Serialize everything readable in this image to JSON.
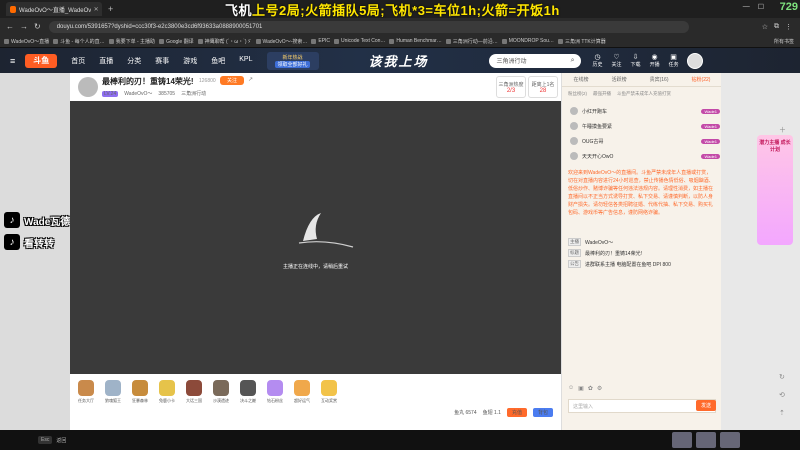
{
  "browser": {
    "tab_title": "WadeOvO～直播_WadeOvO～",
    "url": "douyu.com/5391657?dyshid=ccc30f3-e2c3800e3cd6f93633a0888900051701",
    "bookmarks": [
      "WadeOvO～直播",
      "斗鱼 - 每个人的直…",
      "我要下单 - 主播助",
      "Google 翻译",
      "神鹰聊帮 (´・ω・`)ゞ",
      "WadeOvO～-搜索…",
      "EPIC",
      "Unicode Text Con…",
      "Human Benchmar…",
      "三角洲行动—前沿…",
      "MOONDROP Sou…",
      "三角洲 TTK计算器"
    ],
    "bookmarks_right": "所有书签"
  },
  "overlay": {
    "title_prefix": "飞机",
    "title_mid": "上号2局;火箭插队5局;飞机*3=车位1h;火箭=开饭1h",
    "corner_number": "729"
  },
  "site": {
    "logo": "斗鱼",
    "nav": [
      "首页",
      "直播",
      "分类",
      "赛事",
      "游戏",
      "鱼吧",
      "KPL"
    ],
    "promo_line1": "新年热战",
    "promo_line2": "领取全部好礼",
    "banner": "该我上场",
    "search_placeholder": "三角洲行动",
    "header_icons": [
      "历史",
      "关注",
      "下载",
      "开播",
      "任务"
    ]
  },
  "stream": {
    "title": "最棒利的刃！重铸14荣光!",
    "room_id": "126800",
    "follow_label": "关注",
    "level": "LV.24",
    "streamer": "WadeOvO～",
    "fans": "385705",
    "category": "三角洲行动",
    "rank1_label": "三角洲热度",
    "rank1_value": "2/3",
    "rank2_label": "距离上1名",
    "rank2_value": "28"
  },
  "player": {
    "message": "主播正在连线中，请稍后重试"
  },
  "gifts": [
    {
      "name": "任务大厅",
      "color": "#c98a4b"
    },
    {
      "name": "狼魂狐王",
      "color": "#9fb3c8"
    },
    {
      "name": "狂暴森林",
      "color": "#c78c3c"
    },
    {
      "name": "兔鹿小卡",
      "color": "#e6c34a"
    },
    {
      "name": "大话三国",
      "color": "#8c4a3a"
    },
    {
      "name": "沙漠遗迹",
      "color": "#7a6a5a"
    },
    {
      "name": "决斗之巅",
      "color": "#555"
    },
    {
      "name": "钻石粉丝",
      "color": "#b48cf0"
    },
    {
      "name": "超好运气",
      "color": "#f0a84b"
    },
    {
      "name": "互动奖赏",
      "color": "#f2c34a"
    }
  ],
  "gift_footer": {
    "fishballs": "鱼丸 6574",
    "fishwings": "鱼翅 1.1",
    "recharge": "充值",
    "backpack": "背包"
  },
  "chat": {
    "tabs": [
      "在线榜",
      "活跃榜",
      "贵宾(16)",
      "钻粉(22)"
    ],
    "active_tab": 3,
    "filters": [
      "粉丝榜(2)",
      "最强开播",
      "斗鱼严禁未成年人充值打赏"
    ],
    "ranks": [
      {
        "name": "小红开跑车",
        "badge": "Wade1"
      },
      {
        "name": "午睡摸鱼要紧",
        "badge": "Wade1"
      },
      {
        "name": "OUG古哥",
        "badge": "Wade1"
      },
      {
        "name": "天天开心OwO",
        "badge": "Wade1"
      }
    ],
    "welcome": "欢迎来到WadeOvO～的直播间。斗鱼严禁未成年人直播或打赏，切在对直播内容进行24小时巡查，禁止传播色情低俗、吸烟酗酒、低俗炒作、赌博诈骗等任何违法违规内容。请理性消费，如主播在直播间以不正当方式诱导打赏、私下交易、请谨慎判断，以防人身财产损失。请勿轻信各类招聘征婚、代练代抽、私下交易、购买礼包码、游戏币等广告信息，谨防网络诈骗。",
    "host_key": "主播",
    "host_value": "WadeOvO～",
    "title_key": "标题",
    "title_value": "最棒利的刃！重铸14荣光!",
    "notice_key": "公告",
    "notice_value": "进群联系主播 电脑配置在鱼吧 DPI 800",
    "input_placeholder": "这里输入",
    "send_label": "发送"
  },
  "sidebar_right": {
    "promo_title": "潜力主播 成长计划"
  },
  "overlay_left": {
    "line1": "Wade瓦德",
    "line2": "看转转"
  },
  "taskbar": {
    "chip": "Esc",
    "label": "返回"
  }
}
